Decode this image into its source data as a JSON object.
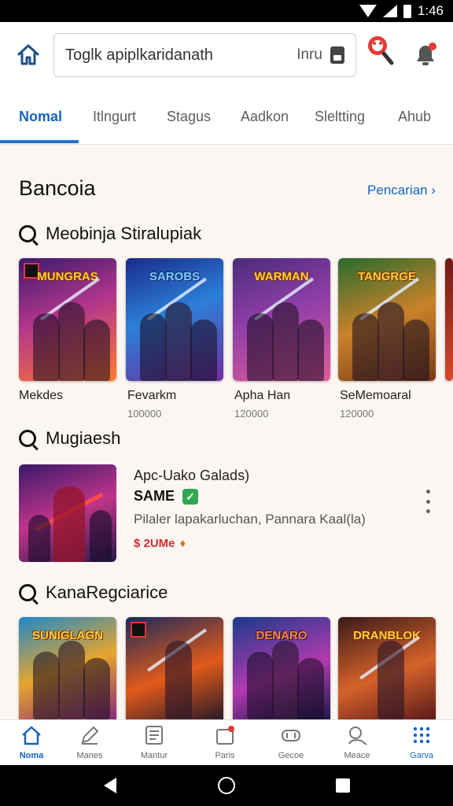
{
  "status_bar": {
    "time": "1:46"
  },
  "search": {
    "value": "Toglk apiplkaridanath",
    "mic_label": "Inru"
  },
  "tabs": [
    {
      "label": "Nomal",
      "active": true
    },
    {
      "label": "Itlngurt",
      "active": false
    },
    {
      "label": "Stagus",
      "active": false
    },
    {
      "label": "Aadkon",
      "active": false
    },
    {
      "label": "Sleltting",
      "active": false
    },
    {
      "label": "Ahub",
      "active": false
    }
  ],
  "page": {
    "title": "Bancoia",
    "see_all": "Pencarian"
  },
  "section1": {
    "title": "Meobinja Stiralupiak",
    "cards": [
      {
        "logo": "MUNGRAS",
        "title": "Mekdes",
        "sub": ""
      },
      {
        "logo": "SAROBS",
        "title": "Fevarkm",
        "sub": "100000"
      },
      {
        "logo": "WARMAN",
        "title": "Apha Han",
        "sub": "120000"
      },
      {
        "logo": "TANGRGE",
        "title": "SeMemoaral",
        "sub": "120000"
      }
    ]
  },
  "section2": {
    "title": "Mugiaesh",
    "featured": {
      "title": "Apc-Uako Galads)",
      "name": "SAME",
      "verified": "✓",
      "desc": "Pilaler lapakarluchan, Pannara Kaal(la)",
      "price": "$ 2UMe"
    }
  },
  "section3": {
    "title": "KanaRegciarice",
    "cards": [
      {
        "logo": "SUNIGLAGN"
      },
      {
        "logo": ""
      },
      {
        "logo": "DENARO"
      },
      {
        "logo": "DRANBLOK"
      }
    ]
  },
  "bottom_nav": [
    {
      "label": "Noma",
      "icon": "home-icon",
      "active": true
    },
    {
      "label": "Manes",
      "icon": "pen-icon",
      "active": false
    },
    {
      "label": "Mantur",
      "icon": "list-icon",
      "active": false
    },
    {
      "label": "Paris",
      "icon": "bag-icon",
      "active": false
    },
    {
      "label": "Gecoe",
      "icon": "gamepad-icon",
      "active": false
    },
    {
      "label": "Meace",
      "icon": "search-person-icon",
      "active": false
    },
    {
      "label": "Garva",
      "icon": "grid-icon",
      "active": false
    }
  ],
  "colors": {
    "accent": "#1565c0",
    "verified": "#2fa84f",
    "price": "#d32f2f"
  }
}
